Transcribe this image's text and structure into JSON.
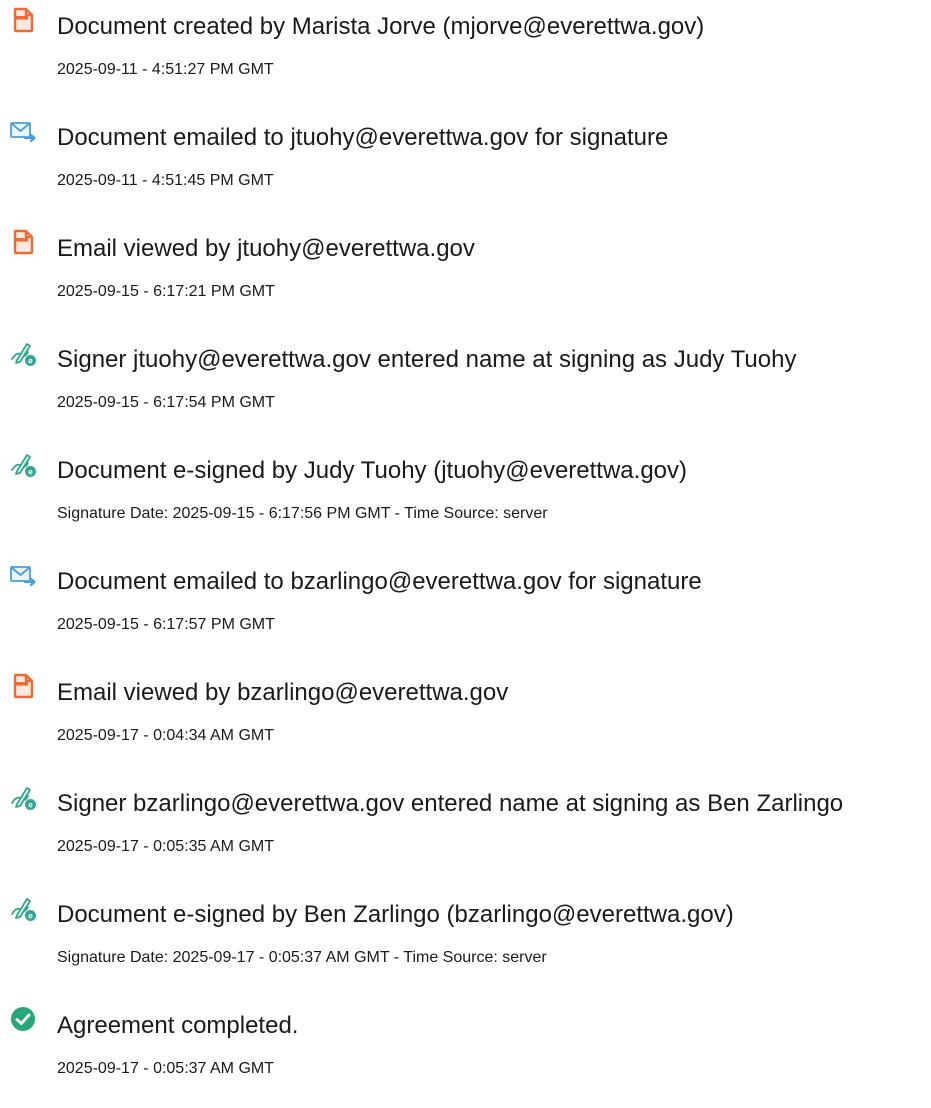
{
  "events": [
    {
      "icon": "document-created-icon",
      "title": "Document created by Marista Jorve (mjorve@everettwa.gov)",
      "detail": "2025-09-11 - 4:51:27 PM GMT"
    },
    {
      "icon": "document-emailed-icon",
      "title": "Document emailed to jtuohy@everettwa.gov for signature",
      "detail": "2025-09-11 - 4:51:45 PM GMT"
    },
    {
      "icon": "email-viewed-icon",
      "title": "Email viewed by jtuohy@everettwa.gov",
      "detail": "2025-09-15 - 6:17:21 PM GMT"
    },
    {
      "icon": "e-sign-icon",
      "title": "Signer jtuohy@everettwa.gov entered name at signing as Judy Tuohy",
      "detail": "2025-09-15 - 6:17:54 PM GMT"
    },
    {
      "icon": "e-sign-icon",
      "title": "Document e-signed by Judy Tuohy (jtuohy@everettwa.gov)",
      "detail": "Signature Date: 2025-09-15 - 6:17:56 PM GMT - Time Source: server"
    },
    {
      "icon": "document-emailed-icon",
      "title": "Document emailed to bzarlingo@everettwa.gov for signature",
      "detail": "2025-09-15 - 6:17:57 PM GMT"
    },
    {
      "icon": "email-viewed-icon",
      "title": "Email viewed by bzarlingo@everettwa.gov",
      "detail": "2025-09-17 - 0:04:34 AM GMT"
    },
    {
      "icon": "e-sign-icon",
      "title": "Signer bzarlingo@everettwa.gov entered name at signing as Ben Zarlingo",
      "detail": "2025-09-17 - 0:05:35 AM GMT"
    },
    {
      "icon": "e-sign-icon",
      "title": "Document e-signed by Ben Zarlingo (bzarlingo@everettwa.gov)",
      "detail": "Signature Date: 2025-09-17 - 0:05:37 AM GMT - Time Source: server"
    },
    {
      "icon": "agreement-completed-icon",
      "title": "Agreement completed.",
      "detail": "2025-09-17 - 0:05:37 AM GMT"
    }
  ],
  "colors": {
    "doc_orange": "#f06a35",
    "mail_blue": "#4a9ed8",
    "sign_green": "#34a68f",
    "check_green": "#2aa67b"
  }
}
